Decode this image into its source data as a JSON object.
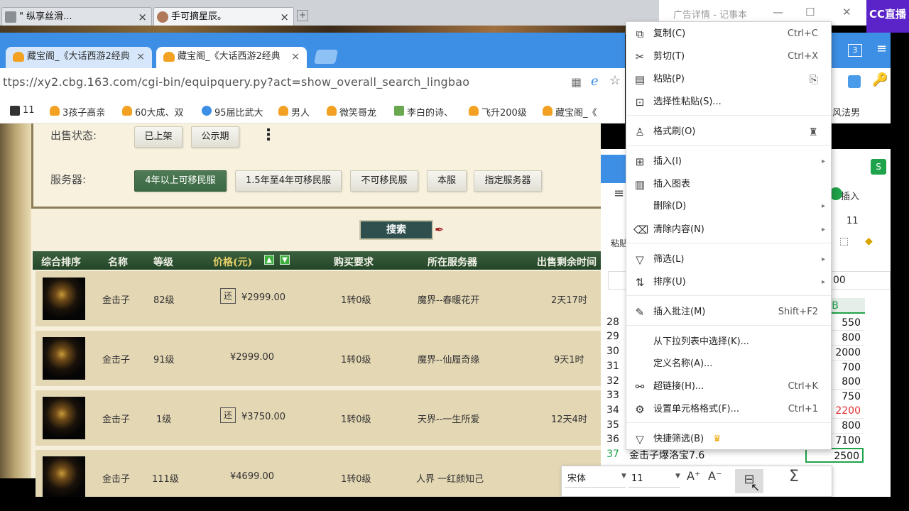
{
  "outer_tabs": [
    {
      "label": "\" 纵享丝滑..."
    },
    {
      "label": "手可摘星辰。"
    }
  ],
  "notepad": {
    "title": "广告详情 - 记事本"
  },
  "brand": {
    "logo_text": "CC直播"
  },
  "browser": {
    "tabs": [
      {
        "label": "藏宝阁_《大话西游2经典"
      },
      {
        "label": "藏宝阁_《大话西游2经典"
      }
    ],
    "url": "ttps://xy2.cbg.163.com/cgi-bin/equipquery.py?act=show_overall_search_lingbao",
    "tab_counter": "3",
    "bookmarks": [
      "11",
      "3孩子高亲",
      "60大成、双",
      "95届比武大",
      "男人",
      "微笑哥龙",
      "李白的诗、",
      "飞升200级",
      "藏宝阁_《",
      "风法男"
    ]
  },
  "filters": {
    "sale_status_label": "出售状态:",
    "sale_status_options": [
      "已上架",
      "公示期"
    ],
    "more_icon": "⋮",
    "server_label": "服务器:",
    "server_options": [
      "4年以上可移民服",
      "1.5年至4年可移民服",
      "不可移民服",
      "本服",
      "指定服务器"
    ],
    "search_label": "搜索"
  },
  "table": {
    "headers": [
      "综合排序",
      "名称",
      "等级",
      "价格(元)",
      "购买要求",
      "所在服务器",
      "出售剩余时间"
    ],
    "rows": [
      {
        "name": "金击子",
        "level": "82级",
        "returnable": true,
        "price": "¥2999.00",
        "req": "1转0级",
        "server": "魔界--春暖花开",
        "time": "2天17时"
      },
      {
        "name": "金击子",
        "level": "91级",
        "returnable": false,
        "price": "¥2999.00",
        "req": "1转0级",
        "server": "魔界--仙履奇缘",
        "time": "9天1时"
      },
      {
        "name": "金击子",
        "level": "1级",
        "returnable": true,
        "price": "¥3750.00",
        "req": "1转0级",
        "server": "天界--一生所爱",
        "time": "12天4时"
      },
      {
        "name": "金击子",
        "level": "111级",
        "returnable": false,
        "price": "¥4699.00",
        "req": "1转0级",
        "server": "人界 一红颜知己",
        "time": "5天"
      }
    ],
    "return_badge": "还"
  },
  "spreadsheet": {
    "insert_tab": "插入",
    "paste_label": "粘贴",
    "font_size": "11",
    "cell_ref_fragment": "00",
    "col_header": "B",
    "row_numbers": [
      "28",
      "29",
      "30",
      "31",
      "32",
      "33",
      "34",
      "35",
      "36",
      "37"
    ],
    "col_b_values": [
      "550",
      "800",
      "2000",
      "700",
      "800",
      "750",
      "2200",
      "800",
      "7100",
      "2500"
    ],
    "highlight_color": "#e03030",
    "row37_a_text": "金击子爆洛宝7.6"
  },
  "context_menu": {
    "items": [
      {
        "icon": "⧉",
        "label": "复制(C)",
        "shortcut": "Ctrl+C"
      },
      {
        "icon": "✂",
        "label": "剪切(T)",
        "shortcut": "Ctrl+X"
      },
      {
        "icon": "📋",
        "label": "粘贴(P)",
        "shortcut": ""
      },
      {
        "icon": "⊡",
        "label": "选择性粘贴(S)...",
        "shortcut": ""
      },
      {
        "icon": "🖌",
        "label": "格式刷(O)",
        "shortcut": ""
      },
      {
        "icon": "⊞",
        "label": "插入(I)",
        "shortcut": ""
      },
      {
        "icon": "▥",
        "label": "插入图表",
        "shortcut": ""
      },
      {
        "icon": "",
        "label": "删除(D)",
        "shortcut": ""
      },
      {
        "icon": "⌫",
        "label": "清除内容(N)",
        "shortcut": ""
      },
      {
        "icon": "▽",
        "label": "筛选(L)",
        "shortcut": ""
      },
      {
        "icon": "⇅",
        "label": "排序(U)",
        "shortcut": ""
      },
      {
        "icon": "✎",
        "label": "插入批注(M)",
        "shortcut": "Shift+F2"
      },
      {
        "icon": "",
        "label": "从下拉列表中选择(K)...",
        "shortcut": ""
      },
      {
        "icon": "",
        "label": "定义名称(A)...",
        "shortcut": ""
      },
      {
        "icon": "🔗",
        "label": "超链接(H)...",
        "shortcut": "Ctrl+K"
      },
      {
        "icon": "⚙",
        "label": "设置单元格格式(F)...",
        "shortcut": "Ctrl+1"
      },
      {
        "icon": "▽",
        "label": "快捷筛选(B)",
        "shortcut": ""
      }
    ],
    "crown_icon": "♛"
  },
  "mini_toolbar": {
    "font_name": "宋体",
    "font_size": "11",
    "grow_font": "A⁺",
    "shrink_font": "A⁻",
    "sum_icon": "Σ"
  }
}
